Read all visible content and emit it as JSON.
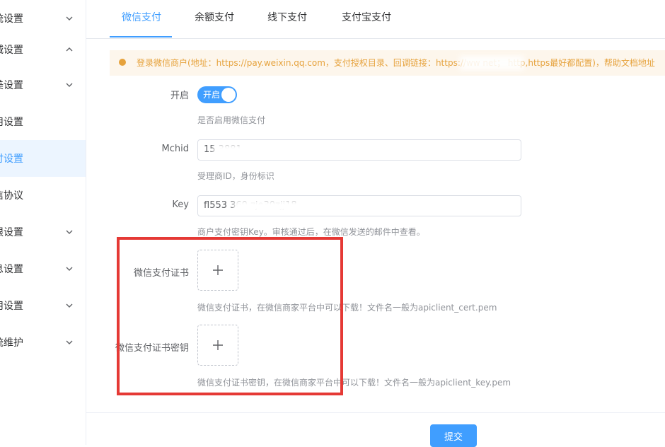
{
  "sidebar": {
    "items": [
      {
        "label": "统设置",
        "chevron": "down"
      },
      {
        "label": "城设置",
        "chevron": "up"
      },
      {
        "label": "美设置",
        "chevron": "down"
      },
      {
        "label": "用设置",
        "chevron": ""
      },
      {
        "label": "付设置",
        "chevron": "",
        "active": true
      },
      {
        "label": "信协议",
        "chevron": ""
      },
      {
        "label": "限设置",
        "chevron": "down"
      },
      {
        "label": "息设置",
        "chevron": "down"
      },
      {
        "label": "用设置",
        "chevron": "down"
      },
      {
        "label": "统维护",
        "chevron": "down"
      }
    ]
  },
  "tabs": [
    {
      "label": "微信支付",
      "active": true
    },
    {
      "label": "余额支付"
    },
    {
      "label": "线下支付"
    },
    {
      "label": "支付宝支付"
    }
  ],
  "alert": {
    "text": "登录微信商户(地址：https://pay.weixin.qq.com，支付授权目录、回调链接：https://ww                    net；  http,https最好都配置)，帮助文档地址"
  },
  "form": {
    "enable": {
      "label": "开启",
      "switch_text": "开启",
      "hint": "是否启用微信支付"
    },
    "mchid": {
      "label": "Mchid",
      "value": "15          3881",
      "hint": "受理商ID，身份标识"
    },
    "key": {
      "label": "Key",
      "value": "fl553                        360 zje30zjj18",
      "hint": "商户支付密钥Key。审核通过后，在微信发送的邮件中查看。"
    },
    "cert": {
      "label": "微信支付证书",
      "hint": "微信支付证书，在微信商家平台中可以下载！文件名一般为apiclient_cert.pem"
    },
    "cert_key": {
      "label": "微信支付证书密钥",
      "hint": "微信支付证书密钥，在微信商家平台中可以下载！文件名一般为apiclient_key.pem"
    }
  },
  "footer": {
    "submit_label": "提交"
  },
  "colors": {
    "primary": "#409eff",
    "warning": "#e6a23c",
    "highlight": "#e53935"
  }
}
